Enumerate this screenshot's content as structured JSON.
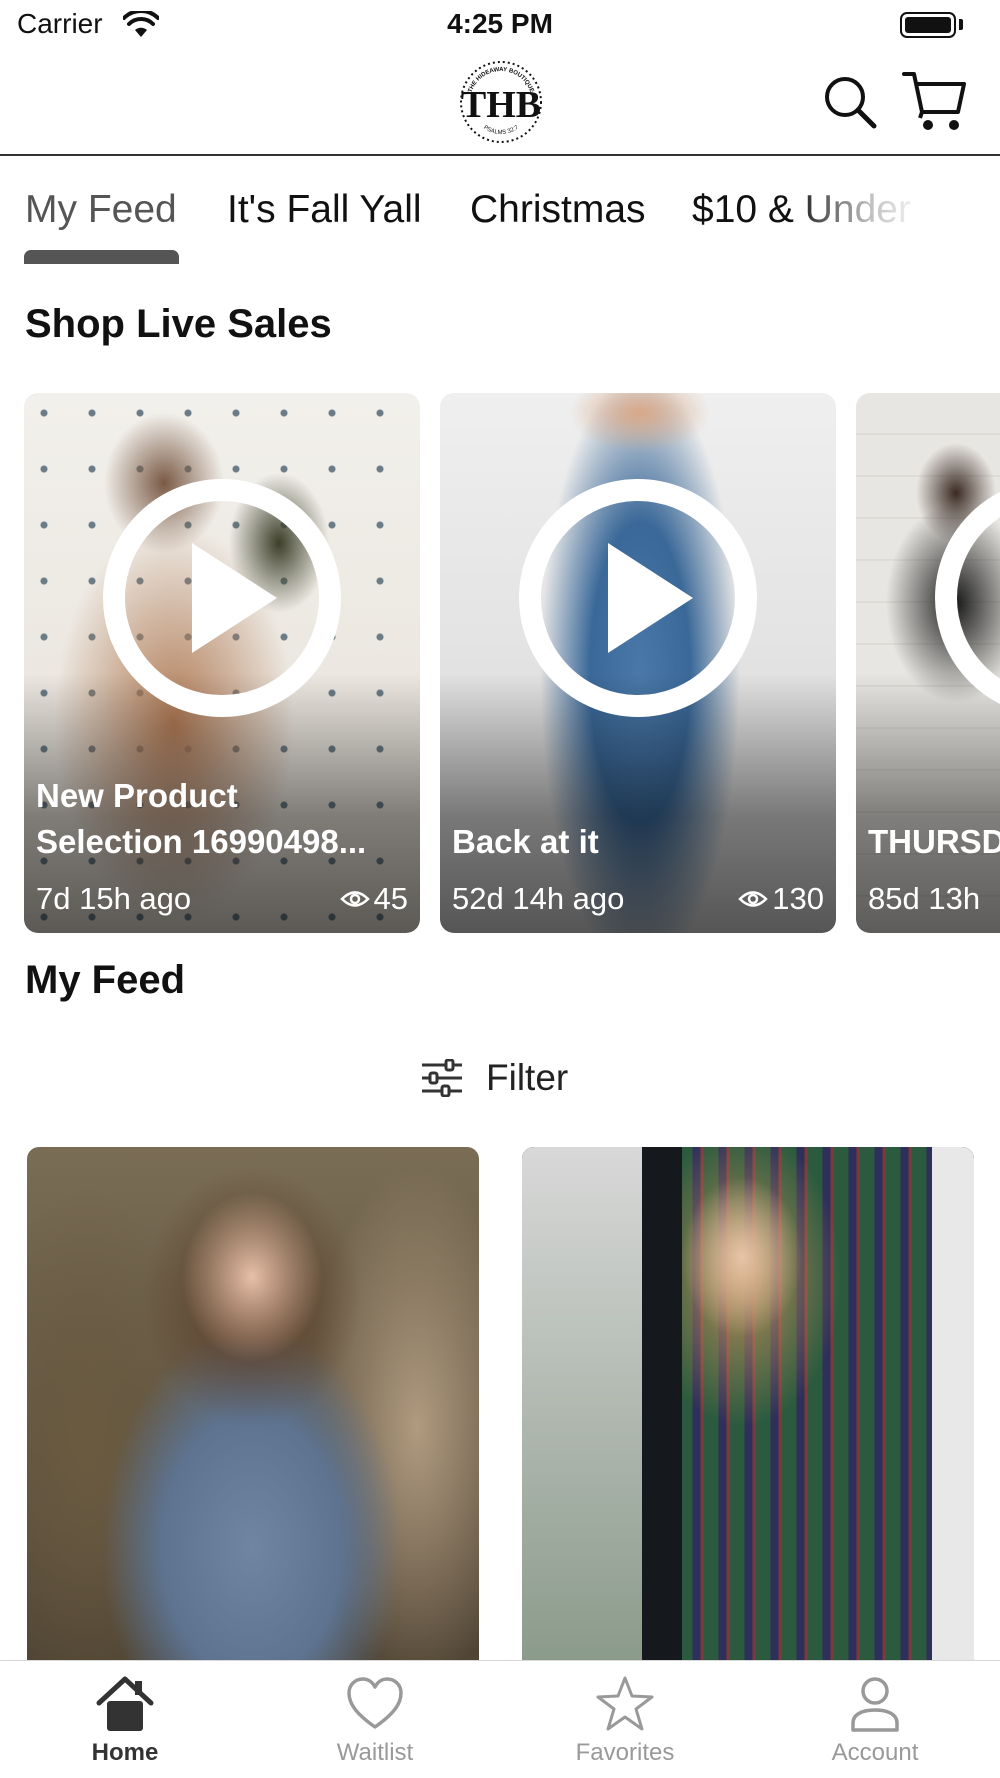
{
  "status_bar": {
    "carrier": "Carrier",
    "time": "4:25 PM"
  },
  "header": {
    "logo_text": "THB",
    "logo_ring_top": "THE HIDEAWAY BOUTIQUE",
    "logo_ring_bottom": "PSALMS 32:7"
  },
  "tabs": [
    {
      "label": "My Feed",
      "active": true
    },
    {
      "label": "It's Fall Yall",
      "active": false
    },
    {
      "label": "Christmas",
      "active": false
    },
    {
      "label": "$10 & Under",
      "active": false
    }
  ],
  "live_sales": {
    "title": "Shop Live Sales",
    "items": [
      {
        "title": "New Product\nSelection 16990498...",
        "age": "7d 15h ago",
        "views": "45"
      },
      {
        "title": "Back at it",
        "age": "52d 14h ago",
        "views": "130"
      },
      {
        "title": "THURSD",
        "age": "85d 13h",
        "views": ""
      }
    ]
  },
  "feed": {
    "title": "My Feed",
    "filter_label": "Filter"
  },
  "tab_bar": [
    {
      "label": "Home",
      "icon": "home-icon",
      "active": true
    },
    {
      "label": "Waitlist",
      "icon": "heart-icon",
      "active": false
    },
    {
      "label": "Favorites",
      "icon": "star-icon",
      "active": false
    },
    {
      "label": "Account",
      "icon": "person-icon",
      "active": false
    }
  ],
  "colors": {
    "text": "#111111",
    "active_indicator": "#555555",
    "inactive_tab": "#999999",
    "overlay_text": "#ffffff"
  }
}
